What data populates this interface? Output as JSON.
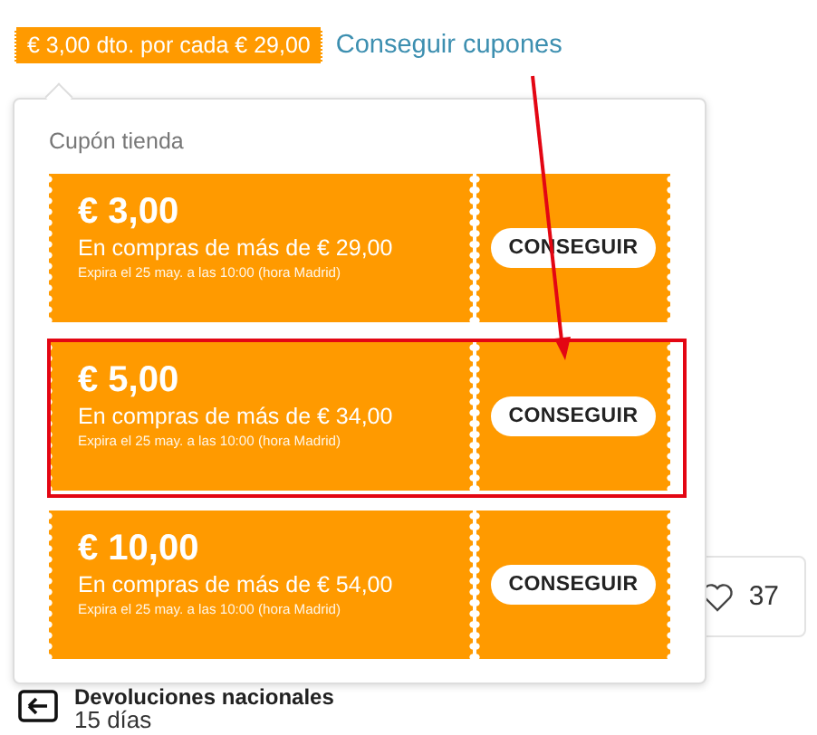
{
  "promo": {
    "badge": "€ 3,00 dto. por cada € 29,00",
    "link": "Conseguir cupones"
  },
  "popup": {
    "title": "Cupón tienda",
    "coupons": [
      {
        "amount": "€ 3,00",
        "condition": "En compras de más de € 29,00",
        "expiry": "Expira el 25 may. a las 10:00 (hora Madrid)",
        "button": "CONSEGUIR",
        "highlighted": false
      },
      {
        "amount": "€ 5,00",
        "condition": "En compras de más de € 34,00",
        "expiry": "Expira el 25 may. a las 10:00 (hora Madrid)",
        "button": "CONSEGUIR",
        "highlighted": true
      },
      {
        "amount": "€ 10,00",
        "condition": "En compras de más de € 54,00",
        "expiry": "Expira el 25 may. a las 10:00 (hora Madrid)",
        "button": "CONSEGUIR",
        "highlighted": false
      }
    ]
  },
  "wishlist": {
    "count": "37"
  },
  "returns": {
    "title": "Devoluciones nacionales",
    "detail": "15 días"
  }
}
